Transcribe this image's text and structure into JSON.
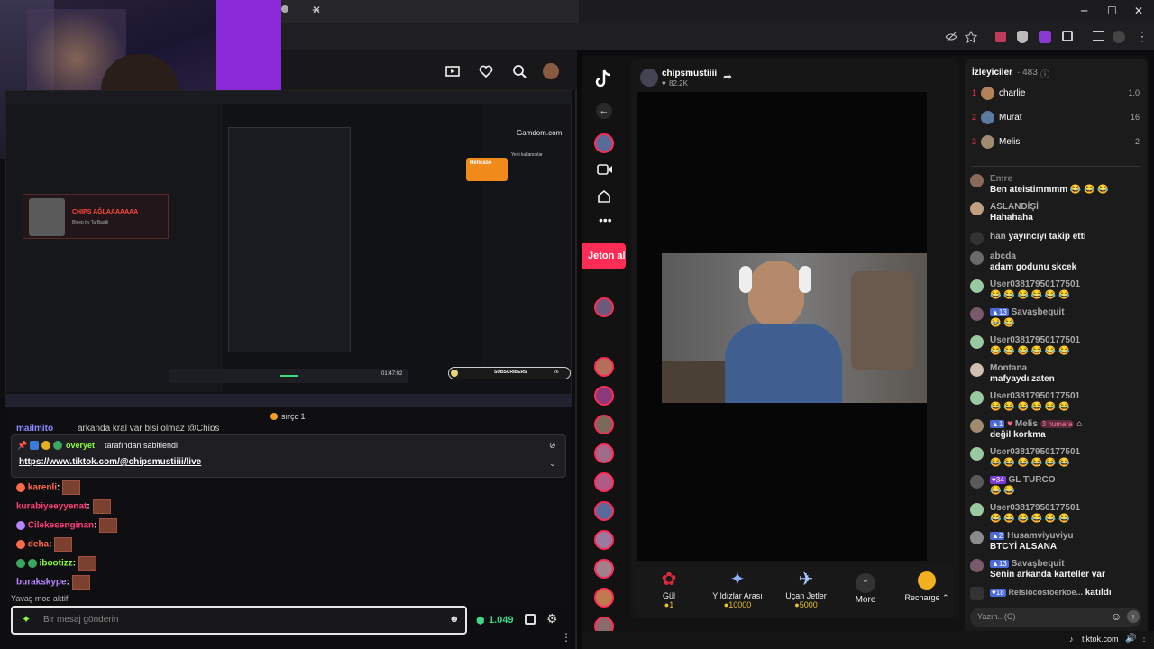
{
  "browser": {
    "win_min": "─",
    "win_max": "☐",
    "win_close": "✕",
    "new_tab": "+",
    "tab_close": "✕"
  },
  "twitch": {
    "viewer_count": "sırçc 1",
    "partial_msg": "arkanda kral var bişi olmaz @Chips",
    "partial_user": "mailmito",
    "pinned_by_user": "overyet",
    "pinned_by_text": "tarafından sabitlendi",
    "pinned_link": "https://www.tiktok.com/@chipsmustiiii/live",
    "messages": [
      {
        "user": "karenli",
        "color": "#ff6a4d"
      },
      {
        "user": "kurabiyeeyyenat",
        "color": "#ff3d7a"
      },
      {
        "user": "Cilekesenginan",
        "color": "#ff3d7a"
      },
      {
        "user": "deha",
        "color": "#ff6a4d"
      },
      {
        "user": "ibootizz",
        "color": "#8cff3a"
      },
      {
        "user": "burakskype",
        "color": "#b784ff"
      }
    ],
    "slow_mode": "Yavaş mod aktif",
    "input_placeholder": "Bir mesaj gönderin",
    "points": "1.049",
    "overlay_title": "CHIPS AĞLAAAAAAA",
    "overlay_sub": "Bleep by TarBaatli",
    "overlay_clip_title": "Yeni kullanıcılar",
    "overlay_subscribers": "SUBSCRIBERS",
    "overlay_subscribers_count": "26",
    "overlay_time": "01:47:02",
    "gamdom": "Gamdom.com",
    "hellcase": "Hellcase"
  },
  "tiktok": {
    "host_name": "chipsmustiiii",
    "host_likes": "82.2K",
    "jeton": "Jeton al",
    "viewers_label": "İzleyiciler",
    "viewers_count": "· 483",
    "ranks": [
      {
        "num": "1",
        "name": "charlie",
        "score": "1.0"
      },
      {
        "num": "2",
        "name": "Murat",
        "score": "16"
      },
      {
        "num": "3",
        "name": "Melis",
        "score": "2"
      }
    ],
    "chat": [
      {
        "user": "Emre",
        "text": "Ben ateistimmmm 😂 😂 😂"
      },
      {
        "user": "ASLANDİŞİ",
        "text": "Hahahaha"
      },
      {
        "user": "han",
        "text": "yayıncıyı takip etti"
      },
      {
        "user": "abcda",
        "text": "adam godunu skcek"
      },
      {
        "user": "User0381795017750​1",
        "text": "😂 😂 😂 😂 😂 😂"
      },
      {
        "user": "Savaşbequit",
        "text": "🥹 😂"
      },
      {
        "user": "User0381795017750​1",
        "text": "😂 😂 😂 😂 😂 😂"
      },
      {
        "user": "Montana",
        "text": "mafyaydı zaten"
      },
      {
        "user": "User0381795017750​1",
        "text": "😂 😂 😂 😂 😂 😂"
      },
      {
        "user": "Melis",
        "text": "değil korkma"
      },
      {
        "user": "User0381795017750​1",
        "text": "😂 😂 😂 😂 😂 😂"
      },
      {
        "user": "GL TURCO",
        "text": "😂 😂"
      },
      {
        "user": "User0381795017750​1",
        "text": "😂 😂 😂 😂 😂 😂"
      },
      {
        "user": "Husamviyuviyu",
        "text": "BTCYİ ALSANA"
      },
      {
        "user": "Savaşbequit",
        "text": "Senin arkanda karteller var"
      },
      {
        "user": "Reislocostoerkoe...",
        "text": "katıldı"
      }
    ],
    "badges": {
      "melis_level": "1",
      "melis_rank": "3 numara",
      "lvl13": "13",
      "lvl1": "1",
      "lvl34": "34",
      "lvl2": "2",
      "lvl18": "18"
    },
    "gifts": [
      {
        "name": "Gül",
        "price": "1"
      },
      {
        "name": "Yıldızlar Arası",
        "price": "10000"
      },
      {
        "name": "Uçan Jetler",
        "price": "5000"
      },
      {
        "name": "More",
        "price": ""
      },
      {
        "name": "Recharge ⌃",
        "price": ""
      }
    ],
    "input_placeholder": "Yazın...(C)",
    "footer": "tiktok.com"
  }
}
